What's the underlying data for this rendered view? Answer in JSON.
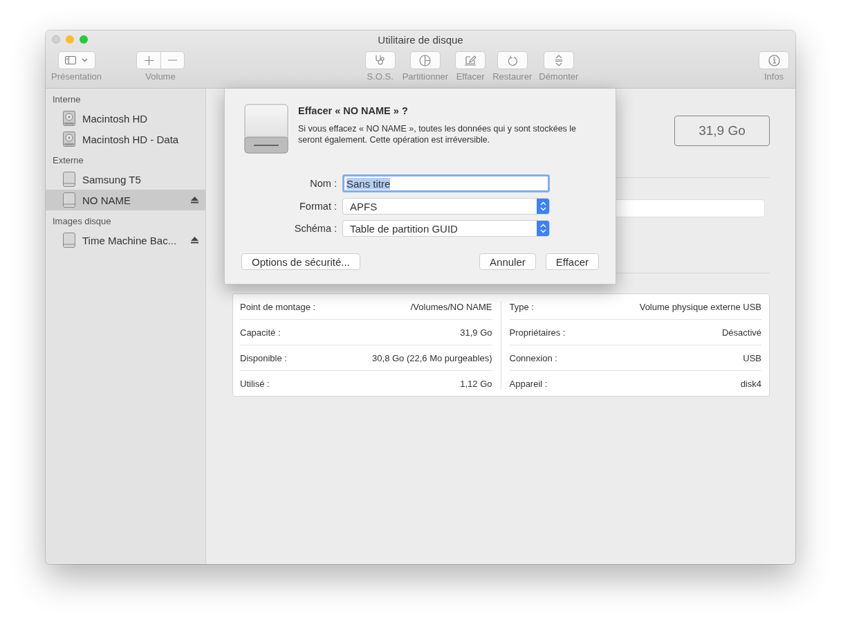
{
  "window": {
    "title": "Utilitaire de disque"
  },
  "toolbar": [
    {
      "kind": "view",
      "label": "Présentation"
    },
    {
      "kind": "volume",
      "label": "Volume"
    },
    {
      "kind": "first-aid",
      "label": "S.O.S."
    },
    {
      "kind": "partition",
      "label": "Partitionner"
    },
    {
      "kind": "erase",
      "label": "Effacer"
    },
    {
      "kind": "restore",
      "label": "Restaurer"
    },
    {
      "kind": "unmount",
      "label": "Démonter"
    },
    {
      "kind": "info",
      "label": "Infos"
    }
  ],
  "sidebar": {
    "sections": [
      {
        "title": "Interne",
        "items": [
          {
            "label": "Macintosh HD",
            "kind": "internal",
            "selected": false,
            "eject": false
          },
          {
            "label": "Macintosh HD - Data",
            "kind": "internal",
            "selected": false,
            "eject": false
          }
        ]
      },
      {
        "title": "Externe",
        "items": [
          {
            "label": "Samsung T5",
            "kind": "external",
            "selected": false,
            "eject": false
          },
          {
            "label": "NO NAME",
            "kind": "external",
            "selected": true,
            "eject": true
          }
        ]
      },
      {
        "title": "Images disque",
        "items": [
          {
            "label": "Time Machine Bac...",
            "kind": "external",
            "selected": false,
            "eject": true
          }
        ]
      }
    ]
  },
  "dialog": {
    "title": "Effacer « NO NAME » ?",
    "message": "Si vous effacez « NO NAME », toutes les données qui y sont stockées le seront également. Cette opération est irréversible.",
    "fields": [
      {
        "label": "Nom :",
        "kind": "text",
        "value": "Sans titre",
        "selected": true
      },
      {
        "label": "Format :",
        "kind": "popup",
        "value": "APFS"
      },
      {
        "label": "Schéma :",
        "kind": "popup",
        "value": "Table de partition GUID"
      }
    ],
    "options_button": "Options de sécurité...",
    "buttons": [
      "Annuler",
      "Effacer"
    ]
  },
  "capacity": "31,9 Go",
  "info": {
    "left": [
      {
        "label": "Point de montage :",
        "value": "/Volumes/NO NAME"
      },
      {
        "label": "Capacité :",
        "value": "31,9 Go"
      },
      {
        "label": "Disponible :",
        "value": "30,8 Go (22,6 Mo purgeables)"
      },
      {
        "label": "Utilisé :",
        "value": "1,12 Go"
      }
    ],
    "right": [
      {
        "label": "Type :",
        "value": "Volume physique externe USB"
      },
      {
        "label": "Propriétaires :",
        "value": "Désactivé"
      },
      {
        "label": "Connexion :",
        "value": "USB"
      },
      {
        "label": "Appareil :",
        "value": "disk4"
      }
    ]
  }
}
